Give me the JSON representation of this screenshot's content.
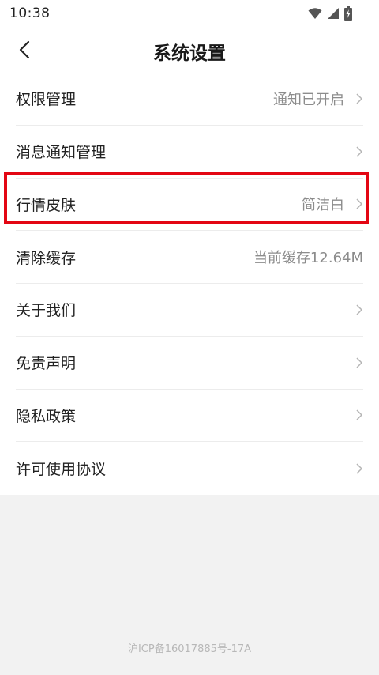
{
  "status_bar": {
    "time": "10:38"
  },
  "header": {
    "title": "系统设置",
    "back_icon": "chevron-left-icon"
  },
  "settings": [
    {
      "id": "permissions",
      "label": "权限管理",
      "value": "通知已开启",
      "chevron": true
    },
    {
      "id": "notifications",
      "label": "消息通知管理",
      "value": "",
      "chevron": true
    },
    {
      "id": "market-skin",
      "label": "行情皮肤",
      "value": "简洁白",
      "chevron": true,
      "highlighted": true
    },
    {
      "id": "clear-cache",
      "label": "清除缓存",
      "value": "当前缓存12.64M",
      "chevron": false
    },
    {
      "id": "about",
      "label": "关于我们",
      "value": "",
      "chevron": true
    },
    {
      "id": "disclaimer",
      "label": "免责声明",
      "value": "",
      "chevron": true
    },
    {
      "id": "privacy",
      "label": "隐私政策",
      "value": "",
      "chevron": true
    },
    {
      "id": "license",
      "label": "许可使用协议",
      "value": "",
      "chevron": true
    }
  ],
  "footer": {
    "icp": "沪ICP备16017885号-17A"
  },
  "colors": {
    "highlight": "#e30613",
    "background": "#f2f2f2",
    "text": "#222222",
    "secondary_text": "#8c8c8c"
  }
}
